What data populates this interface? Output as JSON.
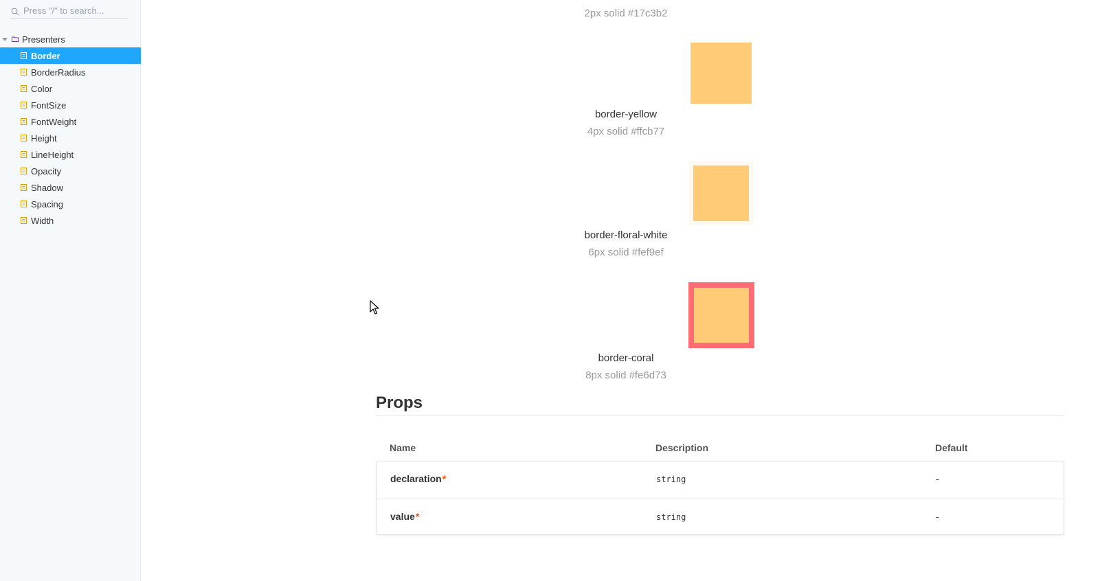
{
  "sidebar": {
    "search": {
      "placeholder": "Press \"/\" to search...",
      "value": ""
    },
    "folder": {
      "label": "Presenters"
    },
    "items": [
      {
        "label": "Border",
        "active": true
      },
      {
        "label": "BorderRadius"
      },
      {
        "label": "Color"
      },
      {
        "label": "FontSize"
      },
      {
        "label": "FontWeight"
      },
      {
        "label": "Height"
      },
      {
        "label": "LineHeight"
      },
      {
        "label": "Opacity"
      },
      {
        "label": "Shadow"
      },
      {
        "label": "Spacing"
      },
      {
        "label": "Width"
      }
    ]
  },
  "swatches": [
    {
      "name": "",
      "desc": "2px solid #17c3b2"
    },
    {
      "name": "border-yellow",
      "desc": "4px solid #ffcb77",
      "border_color": "#ffcb77"
    },
    {
      "name": "border-floral-white",
      "desc": "6px solid #fef9ef",
      "border_color": "#fef9ef"
    },
    {
      "name": "border-coral",
      "desc": "8px solid #fe6d73",
      "border_color": "#fe6d73"
    }
  ],
  "swatch_fill": "#ffcb77",
  "props": {
    "title": "Props",
    "headers": {
      "name": "Name",
      "description": "Description",
      "default": "Default"
    },
    "rows": [
      {
        "name": "declaration",
        "required": "*",
        "type": "string",
        "default": "-"
      },
      {
        "name": "value",
        "required": "*",
        "type": "string",
        "default": "-"
      }
    ]
  },
  "colors": {
    "accent": "#1ea7fd",
    "required": "#ff4400"
  }
}
